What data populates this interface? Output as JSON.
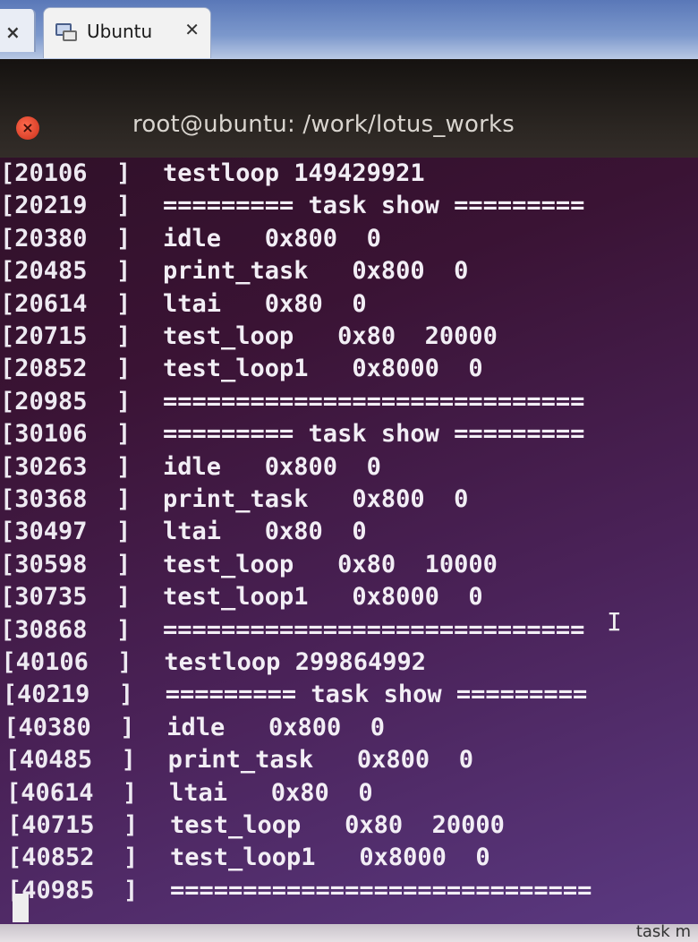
{
  "tabs": {
    "previous_close": "×",
    "active_title": "Ubuntu",
    "active_close": "✕",
    "active_icon": "vm-icon"
  },
  "window": {
    "title": "root@ubuntu: /work/lotus_works",
    "close_icon": "close-icon"
  },
  "terminal": {
    "lines": [
      {
        "ts": "[20106  ]",
        "msg": "testloop 149429921"
      },
      {
        "ts": "[20219  ]",
        "msg": "========= task show ========="
      },
      {
        "ts": "[20380  ]",
        "msg": "idle   0x800  0"
      },
      {
        "ts": "[20485  ]",
        "msg": "print_task   0x800  0"
      },
      {
        "ts": "[20614  ]",
        "msg": "ltai   0x80  0"
      },
      {
        "ts": "[20715  ]",
        "msg": "test_loop   0x80  20000"
      },
      {
        "ts": "[20852  ]",
        "msg": "test_loop1   0x8000  0"
      },
      {
        "ts": "[20985  ]",
        "msg": "============================="
      },
      {
        "ts": "[30106  ]",
        "msg": "========= task show ========="
      },
      {
        "ts": "[30263  ]",
        "msg": "idle   0x800  0"
      },
      {
        "ts": "[30368  ]",
        "msg": "print_task   0x800  0"
      },
      {
        "ts": "[30497  ]",
        "msg": "ltai   0x80  0"
      },
      {
        "ts": "[30598  ]",
        "msg": "test_loop   0x80  10000"
      },
      {
        "ts": "[30735  ]",
        "msg": "test_loop1   0x8000  0"
      },
      {
        "ts": "[30868  ]",
        "msg": "============================="
      },
      {
        "ts": "[40106  ]",
        "msg": "testloop 299864992"
      },
      {
        "ts": "[40219  ]",
        "msg": "========= task show ========="
      },
      {
        "ts": "[40380  ]",
        "msg": "idle   0x800  0"
      },
      {
        "ts": "[40485  ]",
        "msg": "print_task   0x800  0"
      },
      {
        "ts": "[40614  ]",
        "msg": "ltai   0x80  0"
      },
      {
        "ts": "[40715  ]",
        "msg": "test_loop   0x80  20000"
      },
      {
        "ts": "[40852  ]",
        "msg": "test_loop1   0x8000  0"
      },
      {
        "ts": "[40985  ]",
        "msg": "============================="
      }
    ]
  },
  "bottom_bar": {
    "hint": "task m"
  }
}
